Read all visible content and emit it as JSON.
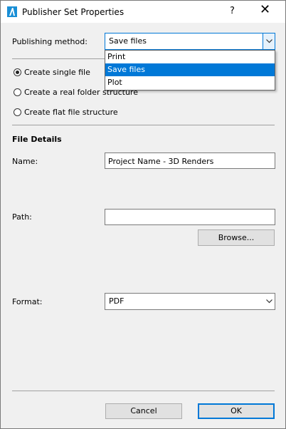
{
  "window": {
    "title": "Publisher Set Properties",
    "help_label": "?",
    "close_label": "✕"
  },
  "publishing": {
    "label": "Publishing method:",
    "selected": "Save files",
    "options": [
      "Print",
      "Save files",
      "Plot"
    ]
  },
  "structure": {
    "options": [
      {
        "label": "Create single file",
        "checked": true
      },
      {
        "label": "Create a real folder structure",
        "checked": false
      },
      {
        "label": "Create flat file structure",
        "checked": false
      }
    ]
  },
  "file_details": {
    "heading": "File Details",
    "name_label": "Name:",
    "name_value": "Project Name - 3D Renders",
    "path_label": "Path:",
    "path_value": "",
    "browse_label": "Browse...",
    "format_label": "Format:",
    "format_value": "PDF"
  },
  "footer": {
    "cancel_label": "Cancel",
    "ok_label": "OK"
  },
  "colors": {
    "accent": "#0078d7",
    "window_bg": "#f0f0f0"
  }
}
